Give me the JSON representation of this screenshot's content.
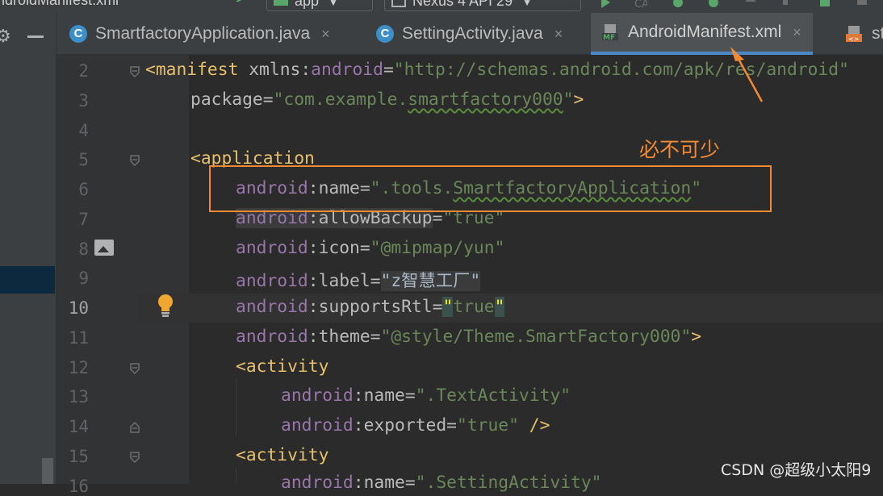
{
  "toolbar": {
    "window_title": "ndroidManifest.xml",
    "run_config": "app",
    "device": "Nexus 4 API 29"
  },
  "tabs": [
    {
      "label": "SmartfactoryApplication.java",
      "icon": "java-class-icon",
      "active": false
    },
    {
      "label": "SettingActivity.java",
      "icon": "java-class-icon",
      "active": false
    },
    {
      "label": "AndroidManifest.xml",
      "icon": "manifest-file-icon",
      "active": true
    },
    {
      "label": "st",
      "icon": "xml-file-icon",
      "active": false
    }
  ],
  "tab_close_glyph": "×",
  "gutter": {
    "line_numbers": [
      "2",
      "3",
      "4",
      "5",
      "6",
      "7",
      "8",
      "9",
      "10",
      "11",
      "12",
      "13",
      "14",
      "15",
      "16"
    ],
    "current_line": "10"
  },
  "code": {
    "l2_tag": "<manifest",
    "l2_attr": " xmlns:",
    "l2_ns": "android",
    "l2_eq": "=",
    "l2_val": "\"http://schemas.android.com/apk/res/android\"",
    "l3_attr": "package",
    "l3_eq": "=",
    "l3_val_a": "\"com.example.",
    "l3_val_b": "smartfactory000",
    "l3_val_c": "\"",
    "l3_close": ">",
    "l5_tag": "<application",
    "l6_ns": "android",
    "l6_attr": ":name",
    "l6_eq": "=",
    "l6_val_a": "\".tools.",
    "l6_val_b": "SmartfactoryApplication",
    "l6_val_c": "\"",
    "l7_ns": "android",
    "l7_attr": ":allowBackup",
    "l7_eq": "=",
    "l7_val": "\"true\"",
    "l8_ns": "android",
    "l8_attr": ":icon",
    "l8_eq": "=",
    "l8_val": "\"@mipmap/yun\"",
    "l9_ns": "android",
    "l9_attr": ":label",
    "l9_eq": "=",
    "l9_val": "\"z智慧工厂\"",
    "l10_ns": "android",
    "l10_attr": ":supportsRtl",
    "l10_eq": "=",
    "l10_q1": "\"",
    "l10_val": "true",
    "l10_q2": "\"",
    "l11_ns": "android",
    "l11_attr": ":theme",
    "l11_eq": "=",
    "l11_val": "\"@style/Theme.SmartFactory000\"",
    "l11_close": ">",
    "l12_tag": "<activity",
    "l13_ns": "android",
    "l13_attr": ":name",
    "l13_eq": "=",
    "l13_val": "\".TextActivity\"",
    "l14_ns": "android",
    "l14_attr": ":exported",
    "l14_eq": "=",
    "l14_val": "\"true\"",
    "l14_close": " />",
    "l15_tag": "<activity",
    "l16_ns": "android",
    "l16_attr": ":name",
    "l16_eq": "=",
    "l16_val": "\".SettingActivity\""
  },
  "annotation": {
    "label": "必不可少",
    "color": "#f28a33"
  },
  "watermark": "CSDN @超级小太阳9",
  "colors": {
    "editor_bg": "#2b2b2b",
    "xml_tag": "#e8bf6a",
    "namespace": "#9876aa",
    "string_value": "#6a8759",
    "attribute": "#bababa"
  }
}
